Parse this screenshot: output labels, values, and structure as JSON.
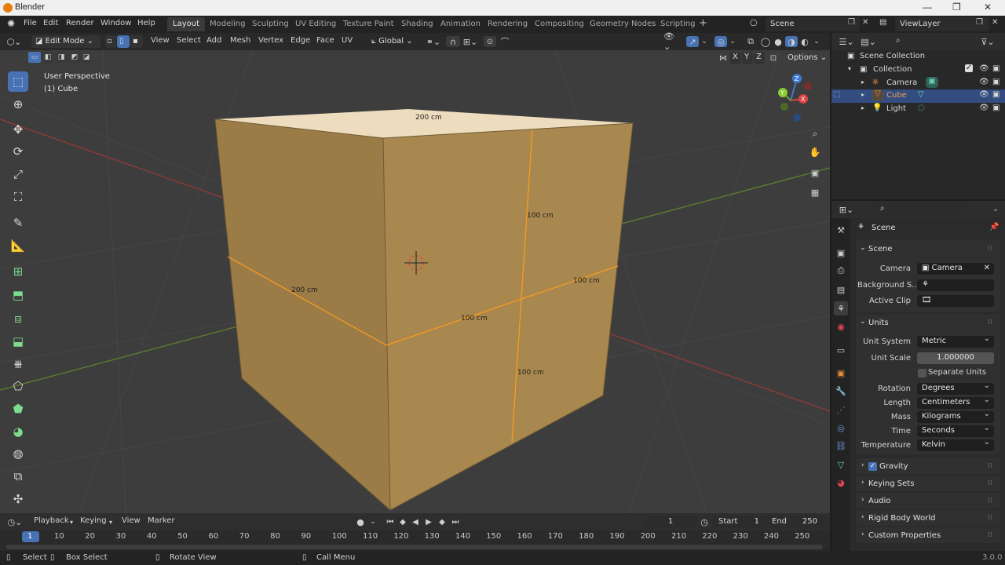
{
  "window": {
    "title": "Blender",
    "version": "3.0.0"
  },
  "menu": [
    "File",
    "Edit",
    "Render",
    "Window",
    "Help"
  ],
  "workspaces": [
    "Layout",
    "Modeling",
    "Sculpting",
    "UV Editing",
    "Texture Paint",
    "Shading",
    "Animation",
    "Rendering",
    "Compositing",
    "Geometry Nodes",
    "Scripting"
  ],
  "active_workspace": "Layout",
  "scene_field": "Scene",
  "viewlayer_field": "ViewLayer",
  "viewport": {
    "mode": "Edit Mode",
    "menus": [
      "View",
      "Select",
      "Add",
      "Mesh",
      "Vertex",
      "Edge",
      "Face",
      "UV"
    ],
    "orientation": "Global",
    "options_label": "Options",
    "axis_buttons": [
      "X",
      "Y",
      "Z"
    ],
    "overlay_title": "User Perspective",
    "overlay_object": "(1) Cube",
    "gizmo": {
      "x": "X",
      "y": "Y",
      "z": "Z"
    },
    "dimensions": [
      "200 cm",
      "200 cm",
      "100 cm",
      "100 cm",
      "100 cm",
      "100 cm"
    ],
    "colors": {
      "bg": "#3d3d3d",
      "cube_top": "#eedcbe",
      "cube_front": "#a9884f",
      "cube_left": "#9b7c47",
      "edge": "#ff9c1c"
    }
  },
  "tools": [
    "select-box",
    "cursor",
    "move",
    "rotate",
    "scale",
    "transform",
    "annotate",
    "measure",
    "add-cube",
    "extrude",
    "inset",
    "bevel",
    "loop-cut",
    "knife",
    "poly-build",
    "spin",
    "smooth",
    "edge-slide",
    "shrink-fatten"
  ],
  "timeline": {
    "menus": [
      "Playback",
      "Keying",
      "View",
      "Marker"
    ],
    "current_frame": "1",
    "start_label": "Start",
    "start": "1",
    "end_label": "End",
    "end": "250",
    "ticks": [
      "1",
      "10",
      "20",
      "30",
      "40",
      "50",
      "60",
      "70",
      "80",
      "90",
      "100",
      "110",
      "120",
      "130",
      "140",
      "150",
      "160",
      "170",
      "180",
      "190",
      "200",
      "210",
      "220",
      "230",
      "240",
      "250"
    ]
  },
  "statusbar": {
    "select": "Select",
    "box_select": "Box Select",
    "rotate_view": "Rotate View",
    "call_menu": "Call Menu"
  },
  "outliner": {
    "root": "Scene Collection",
    "collection": "Collection",
    "items": [
      {
        "name": "Camera",
        "selected": false,
        "color": "#e88f3a"
      },
      {
        "name": "Cube",
        "selected": true,
        "color": "#e88f3a"
      },
      {
        "name": "Light",
        "selected": false,
        "color": "#e88f3a"
      }
    ]
  },
  "properties": {
    "context": "Scene",
    "scene_panel": {
      "title": "Scene",
      "camera_label": "Camera",
      "camera_value": "Camera",
      "background_label": "Background S...",
      "active_clip_label": "Active Clip"
    },
    "units_panel": {
      "title": "Units",
      "unit_system_label": "Unit System",
      "unit_system": "Metric",
      "unit_scale_label": "Unit Scale",
      "unit_scale": "1.000000",
      "separate_units": "Separate Units",
      "rotation_label": "Rotation",
      "rotation": "Degrees",
      "length_label": "Length",
      "length": "Centimeters",
      "mass_label": "Mass",
      "mass": "Kilograms",
      "time_label": "Time",
      "time": "Seconds",
      "temperature_label": "Temperature",
      "temperature": "Kelvin"
    },
    "collapsed_panels": [
      "Gravity",
      "Keying Sets",
      "Audio",
      "Rigid Body World",
      "Custom Properties"
    ]
  }
}
